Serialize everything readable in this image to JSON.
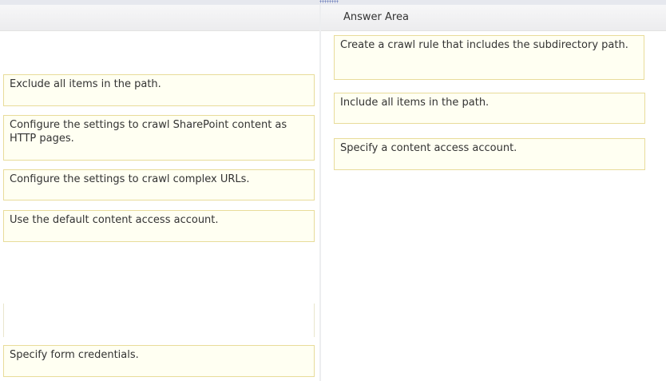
{
  "answer_area": {
    "title": "Answer Area",
    "items": [
      {
        "text": "Create a crawl rule that includes the subdirectory path."
      },
      {
        "text": "Include all items in the path."
      },
      {
        "text": "Specify a content access account."
      }
    ]
  },
  "options": {
    "items": [
      {
        "text": "Exclude all items in the path."
      },
      {
        "text": "Configure the settings to crawl SharePoint content as HTTP pages."
      },
      {
        "text": "Configure the settings to crawl complex URLs."
      },
      {
        "text": "Use the default content access account."
      },
      {
        "text": "Specify form credentials."
      }
    ]
  },
  "colors": {
    "tile_background": "#fffff2",
    "tile_border": "#e8dc9a",
    "header_background": "#efeff1"
  }
}
